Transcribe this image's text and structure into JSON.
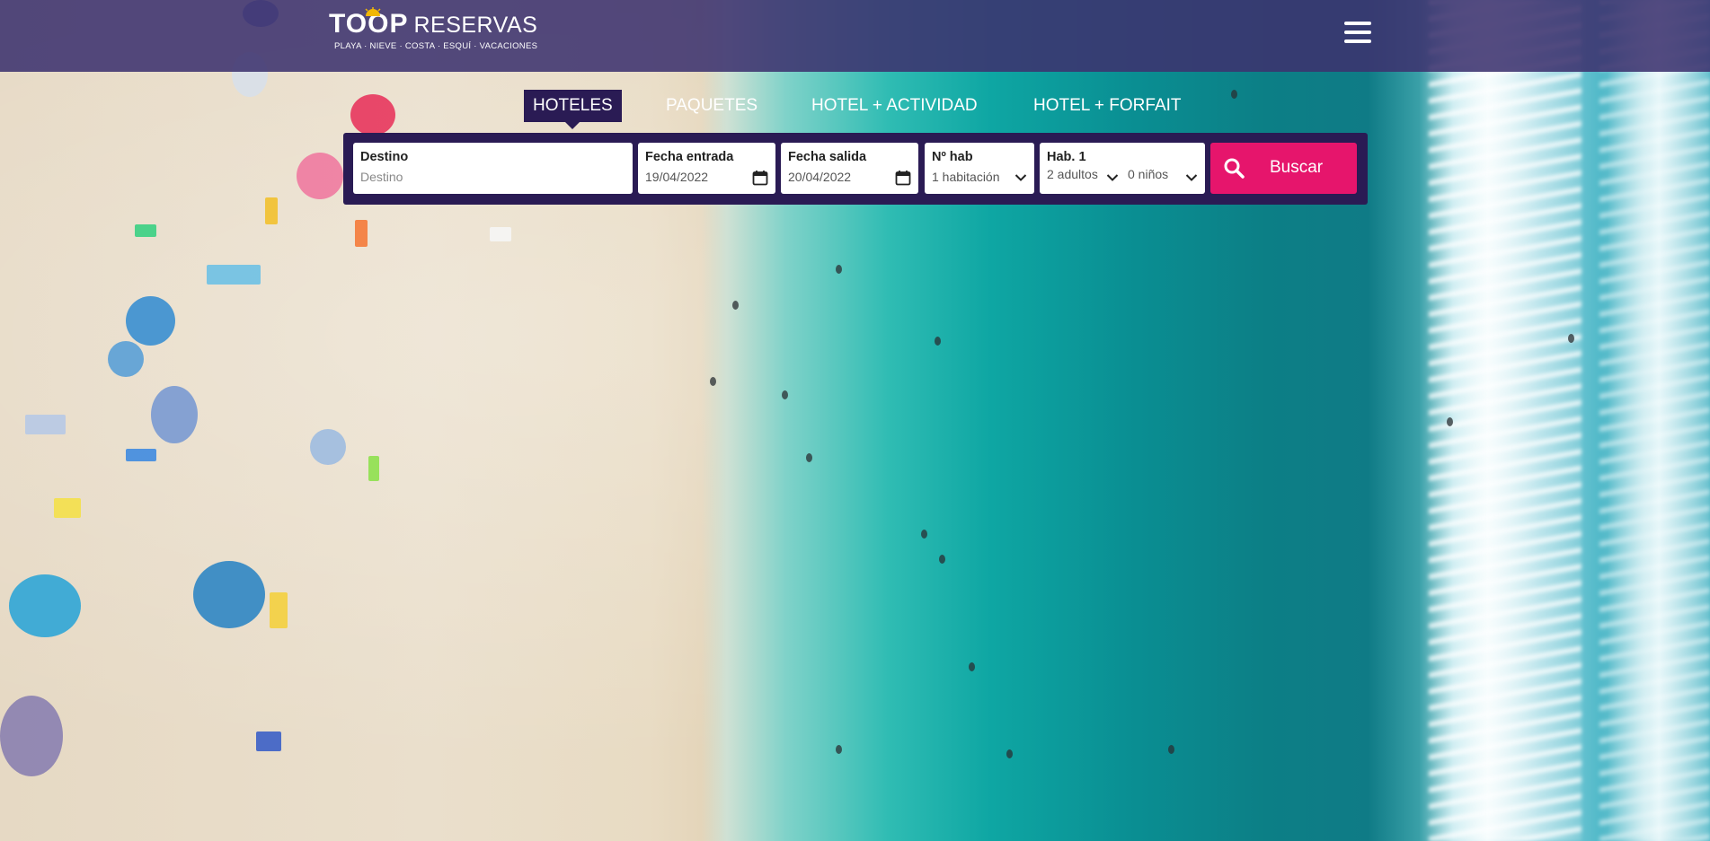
{
  "header": {
    "logo_brand": "TOOP",
    "logo_name": "RESERVAS",
    "logo_tagline": "PLAYA · NIEVE · COSTA · ESQUÍ · VACACIONES",
    "menu_icon": "hamburger-menu-icon"
  },
  "tabs": [
    {
      "label": "HOTELES",
      "active": true
    },
    {
      "label": "PAQUETES",
      "active": false
    },
    {
      "label": "HOTEL + ACTIVIDAD",
      "active": false
    },
    {
      "label": "HOTEL + FORFAIT",
      "active": false
    }
  ],
  "search": {
    "destino": {
      "label": "Destino",
      "placeholder": "Destino",
      "value": ""
    },
    "fecha_entrada": {
      "label": "Fecha entrada",
      "value": "19/04/2022",
      "icon": "calendar-icon"
    },
    "fecha_salida": {
      "label": "Fecha salida",
      "value": "20/04/2022",
      "icon": "calendar-icon"
    },
    "num_hab": {
      "label": "Nº hab",
      "value": "1 habitación"
    },
    "hab1": {
      "label": "Hab. 1",
      "adultos": "2 adultos",
      "ninos": "0 niños"
    },
    "button_label": "Buscar",
    "button_icon": "search-icon"
  },
  "colors": {
    "header_bg": "#3c326e",
    "panel_bg": "#2a1b54",
    "accent": "#e6156c"
  }
}
